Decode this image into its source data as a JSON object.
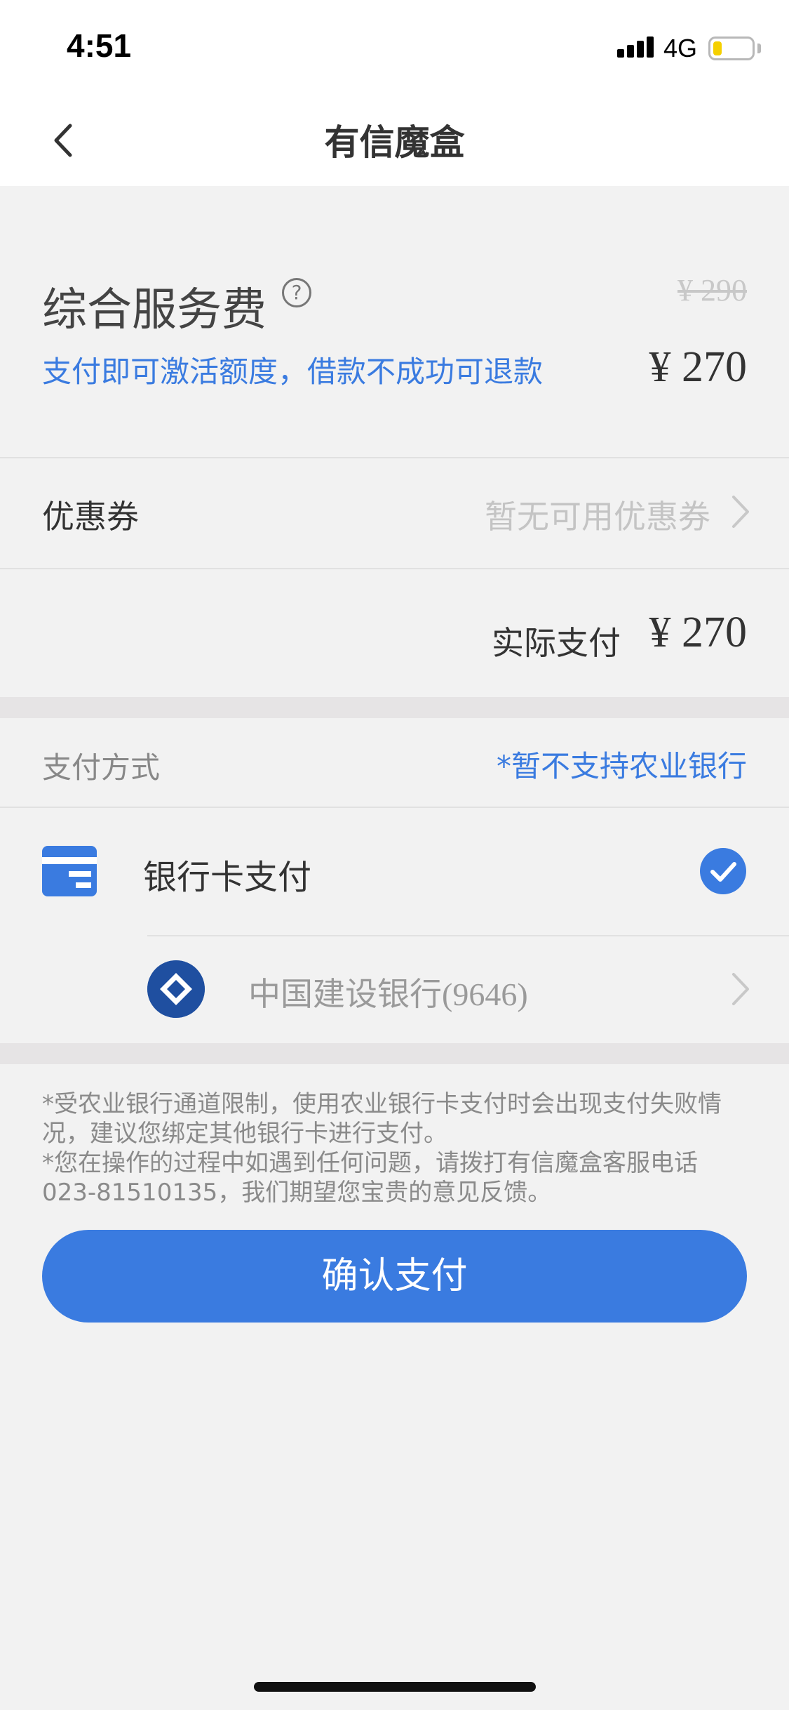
{
  "status_bar": {
    "time": "4:51",
    "network": "4G"
  },
  "nav": {
    "title": "有信魔盒"
  },
  "fee": {
    "title": "综合服务费",
    "help_glyph": "?",
    "old_price": "¥ 290",
    "new_price": "¥ 270",
    "description": "支付即可激活额度，借款不成功可退款"
  },
  "coupon": {
    "label": "优惠券",
    "value": "暂无可用优惠券"
  },
  "actual": {
    "label": "实际支付",
    "price": "¥ 270"
  },
  "payment": {
    "section_label": "支付方式",
    "note": "*暂不支持农业银行",
    "method_label": "银行卡支付",
    "bank_name": "中国建设银行",
    "card_suffix": "(9646)"
  },
  "notice": {
    "line1": "*受农业银行通道限制，使用农业银行卡支付时会出现支付失败情况，建议您绑定其他银行卡进行支付。",
    "line2": "*您在操作的过程中如遇到任何问题，请拨打有信魔盒客服电话023-81510135，我们期望您宝贵的意见反馈。"
  },
  "confirm_button": {
    "label": "确认支付"
  },
  "colors": {
    "accent": "#3a7be0",
    "background": "#f2f2f2",
    "bank_logo": "#1f4fa0"
  }
}
